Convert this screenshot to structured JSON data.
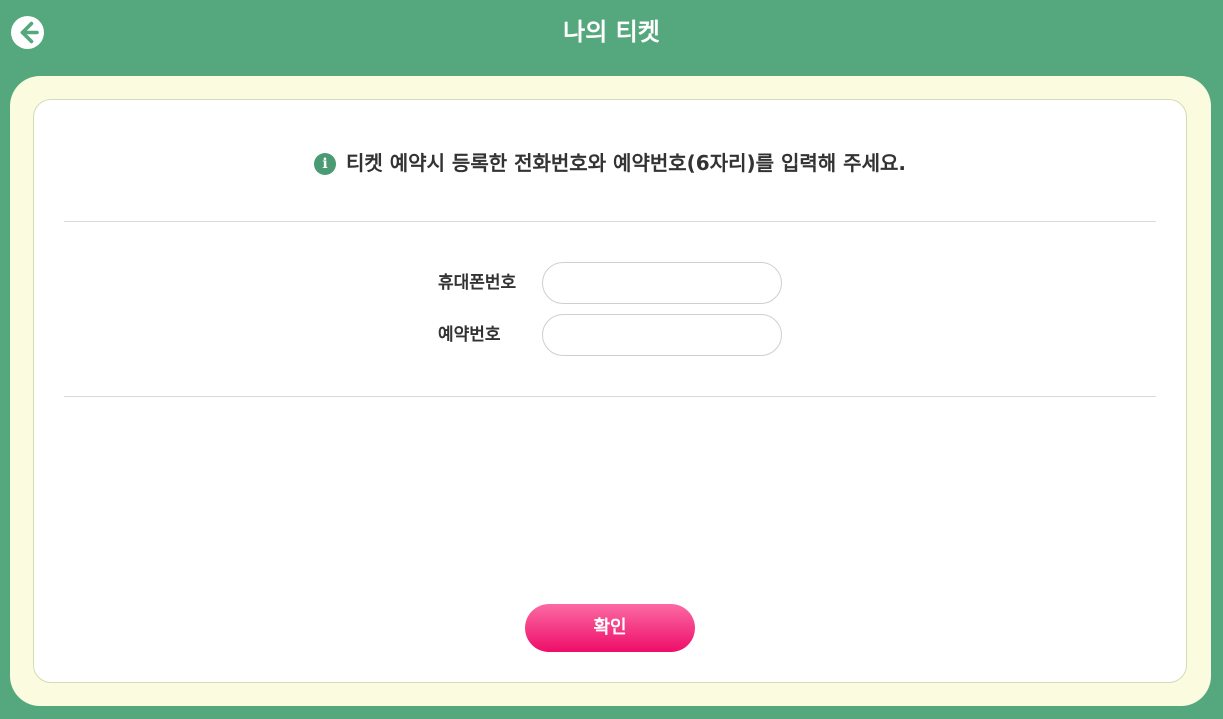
{
  "header": {
    "title": "나의 티켓",
    "back_icon": "arrow-left-circle-icon"
  },
  "colors": {
    "background": "#55a77d",
    "frame": "#fbfcdf",
    "accent": "#ee0d69",
    "info_icon": "#4a9a74"
  },
  "notice": {
    "icon": "info-icon",
    "icon_glyph": "i",
    "text": "티켓 예약시 등록한 전화번호와 예약번호(6자리)를 입력해 주세요."
  },
  "form": {
    "phone_label": "휴대폰번호",
    "phone_value": "",
    "reservation_label": "예약번호",
    "reservation_value": ""
  },
  "actions": {
    "confirm_label": "확인"
  }
}
